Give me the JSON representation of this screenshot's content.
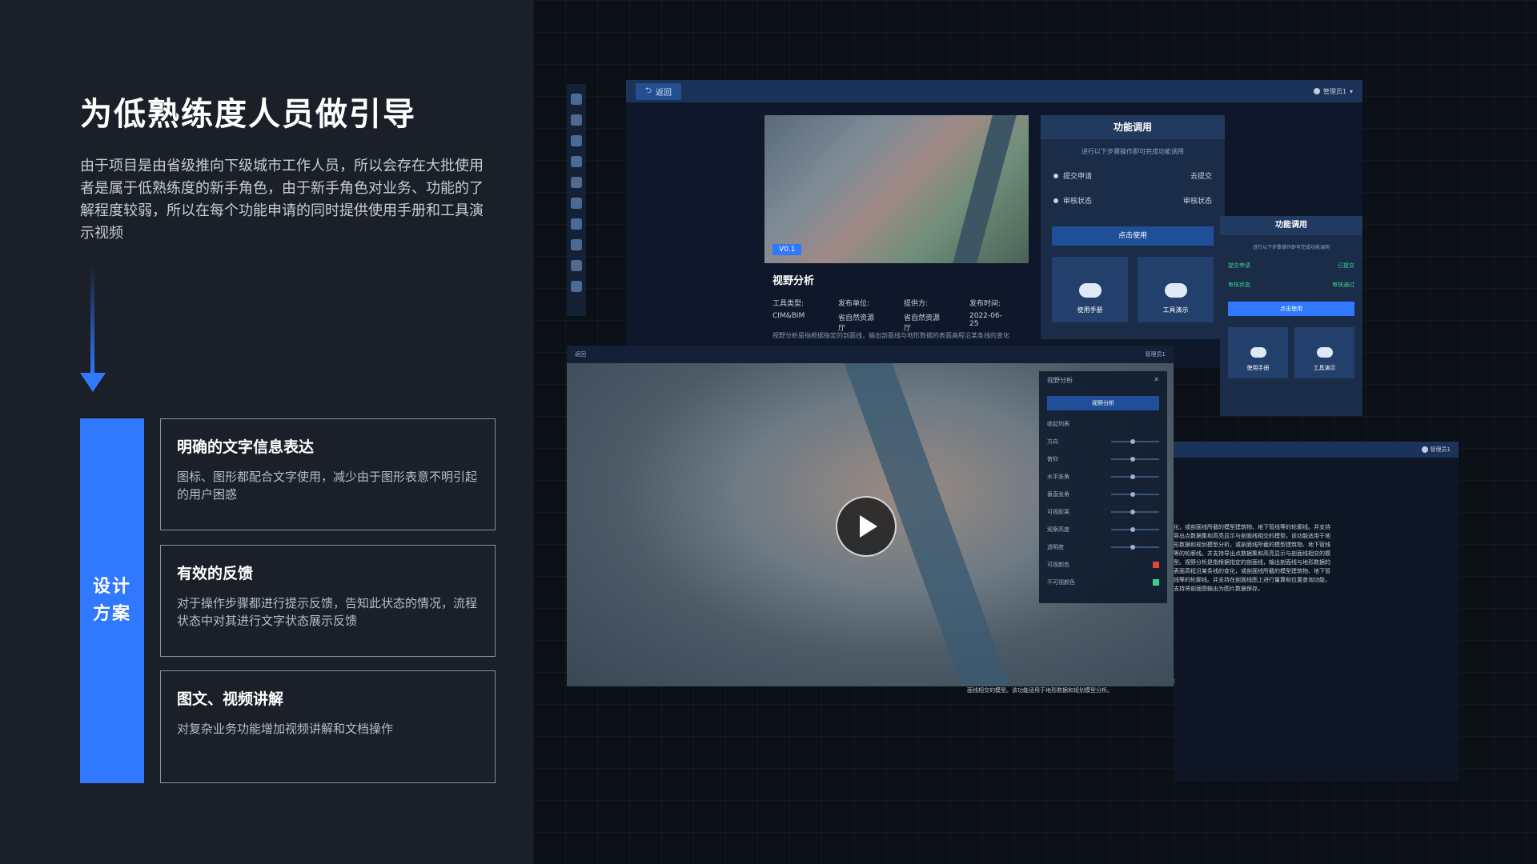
{
  "left": {
    "headline": "为低熟练度人员做引导",
    "intro": "由于项目是由省级推向下级城市工作人员，所以会存在大批使用者是属于低熟练度的新手角色，由于新手角色对业务、功能的了解程度较弱，所以在每个功能申请的同时提供使用手册和工具演示视频",
    "design_line1": "设计",
    "design_line2": "方案",
    "cards": [
      {
        "title": "明确的文字信息表达",
        "desc": "图标、图形都配合文字使用，减少由于图形表意不明引起的用户困惑"
      },
      {
        "title": "有效的反馈",
        "desc": "对于操作步骤都进行提示反馈，告知此状态的情况，流程状态中对其进行文字状态展示反馈"
      },
      {
        "title": "图文、视频讲解",
        "desc": "对复杂业务功能增加视频讲解和文档操作"
      }
    ]
  },
  "main_window": {
    "back_label": "返回",
    "admin_label": "管理员1",
    "version_tag": "V0.1",
    "tool_title": "视野分析",
    "meta_labels": [
      "工具类型:",
      "发布单位:",
      "提供方:",
      "发布时间:"
    ],
    "meta_values": [
      "CIM&BIM",
      "省自然资源厅",
      "省自然资源厅",
      "2022-06-25"
    ],
    "desc": "视野分析是指根据指定的剖面线，输出剖面线与地形数据的表面高程沿某条线的变化"
  },
  "func_panel": {
    "title": "功能调用",
    "subtitle": "进行以下步骤操作即可完成功能调用",
    "steps": [
      {
        "label": "提交申请",
        "action": "去提交"
      },
      {
        "label": "审核状态",
        "action": "审核状态"
      }
    ],
    "use_btn": "点击使用",
    "tiles": [
      "使用手册",
      "工具演示"
    ]
  },
  "func_panel2": {
    "title": "功能调用",
    "subtitle": "进行以下步骤操作即可完成功能调用",
    "steps": [
      {
        "label": "提交申请",
        "status": "已提交"
      },
      {
        "label": "审核状态",
        "status": "审核通过"
      }
    ],
    "use_btn": "点击使用",
    "tiles": [
      "使用手册",
      "工具演示"
    ]
  },
  "video_window": {
    "back_label": "返回",
    "admin_label": "管理员1",
    "panel_title": "视野分析",
    "panel_btn": "视野分析",
    "rows": [
      "收起列表",
      "方向",
      "俯仰",
      "水平张角",
      "垂直张角",
      "可视距离",
      "观察高度",
      "透明度",
      "可视颜色",
      "不可视颜色"
    ],
    "visible_color": "#e0443c",
    "hidden_color": "#3ecf8e"
  },
  "back_window": {
    "admin_label": "管理员1",
    "doc": "化，或剖面线所截的模型建筑物、地下管线等的轮廓线。并支持导出点数据集和高亮显示与剖面线相交的模型。该功能适用于地形数据和规划模型分析，或剖面线所截的模型建筑物、地下管线等的轮廓线。并支持导出点数据集和高亮显示与剖面线相交的模型。视野分析是指根据指定的剖面线，输出剖面线与地形数据的表面高程沿某条线的变化，或剖面线所截的模型建筑物、地下管线等的轮廓线。并支持在剖面线图上进行量算和位置查询功能，支持将剖面图输出为图片数据保存。",
    "doc_left": "剖面线所截的模型建筑物、地下管线等的轮廓线。并支持在剖面线图上进行量算和位置查询功能，支持将剖面图输出为图片数据保存，支持导出点数据集和高亮显示与剖面线相交的模型。该功能适用于地形数据和规划模型分析。"
  }
}
